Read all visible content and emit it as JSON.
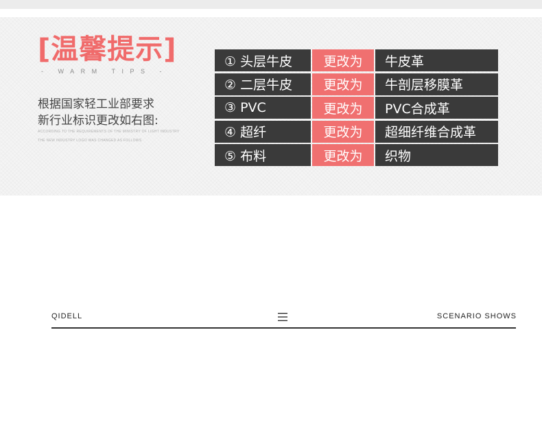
{
  "notice": {
    "title": "[温馨提示]",
    "subtitle": "- WARM TIPS -",
    "description_lines": [
      "根据国家轻工业部要求",
      "新行业标识更改如右图:"
    ],
    "description_en_lines": [
      "ACCORDING TO THE REQUIREMENTS OF THE MINISTRY OF LIGHT INDUSTRY",
      "THE NEW INDUSTRY LOGO WAS CHANGED AS FOLLOWS"
    ]
  },
  "changes": [
    {
      "old": "① 头层牛皮",
      "change": "更改为",
      "new": "牛皮革"
    },
    {
      "old": "② 二层牛皮",
      "change": "更改为",
      "new": "牛剖层移膜革"
    },
    {
      "old": "③ PVC",
      "change": "更改为",
      "new": "PVC合成革"
    },
    {
      "old": "④ 超纤",
      "change": "更改为",
      "new": "超细纤维合成革"
    },
    {
      "old": "⑤ 布料",
      "change": "更改为",
      "new": "织物"
    }
  ],
  "footer": {
    "brand": "QIDELL",
    "section": "SCENARIO SHOWS",
    "menu_icon": "hamburger-menu-icon"
  },
  "colors": {
    "accent": "#f06b6b",
    "table_dark": "#3a3a3a",
    "table_highlight": "#f07070"
  }
}
